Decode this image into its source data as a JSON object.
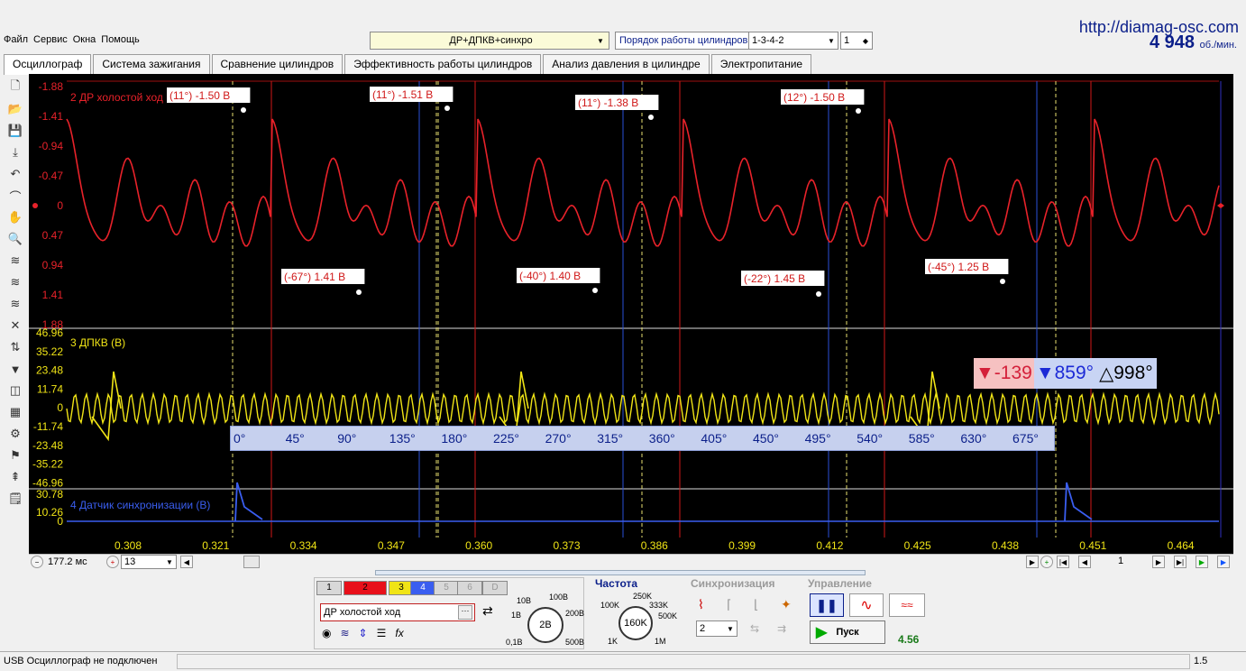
{
  "menu": [
    "Файл",
    "Сервис",
    "Окна",
    "Помощь"
  ],
  "site_url": "http://diamag-osc.com",
  "rpm": {
    "value": "4   948",
    "unit": "об./мин."
  },
  "preset": "ДР+ДПКВ+синхро",
  "cylinder_order": {
    "label": "Порядок работы цилиндров",
    "value": "1-3-4-2",
    "number": "1"
  },
  "tabs": [
    "Осциллограф",
    "Система зажигания",
    "Сравнение цилиндров",
    "Эффективность работы цилиндров",
    "Анализ давления в цилиндре",
    "Электропитание"
  ],
  "active_tab": 0,
  "toolbar_icons": [
    "new-file-icon",
    "open-folder-icon",
    "save-icon",
    "auto-scale-icon",
    "cursor-icon",
    "curve-icon",
    "hand-icon",
    "zoom-icon",
    "waves-icon",
    "waves2-icon",
    "waves3-icon",
    "cross-icon",
    "split-icon",
    "filter-icon",
    "compare-icon",
    "table-icon",
    "settings-auto-icon",
    "flag-icon",
    "marker-icon",
    "note-icon"
  ],
  "scope": {
    "colors": {
      "ch2": "#e8222a",
      "ch3": "#f0e416",
      "ch4": "#3a5ef0",
      "bg": "#000000"
    },
    "ch2": {
      "name": "2 ДР холостой ход",
      "yticks": [
        "-1.88",
        "-1.41",
        "-0.94",
        "-0.47",
        "0",
        "0.47",
        "0.94",
        "1.41",
        "1.88"
      ],
      "labels": [
        "(11°) -1.50 В",
        "(11°) -1.51 В",
        "(11°) -1.38 В",
        "(12°) -1.50 В",
        "(-67°) 1.41 В",
        "(-40°) 1.40 В",
        "(-22°) 1.45 В",
        "(-45°) 1.25 В"
      ]
    },
    "ch3": {
      "name": "3 ДПКВ (В)",
      "yticks": [
        "46.96",
        "35.22",
        "23.48",
        "11.74",
        "0",
        "-11.74",
        "-23.48",
        "-35.22",
        "-46.96"
      ]
    },
    "ch4": {
      "name": "4 Датчик синхронизации (В)",
      "yticks": [
        "30.78",
        "10.26",
        "0"
      ]
    },
    "xticks": [
      "0.308",
      "0.321",
      "0.334",
      "0.347",
      "0.360",
      "0.373",
      "0.386",
      "0.399",
      "0.412",
      "0.425",
      "0.438",
      "0.451",
      "0.464"
    ],
    "angle_ruler": [
      "0°",
      "45°",
      "90°",
      "135°",
      "180°",
      "225°",
      "270°",
      "315°",
      "360°",
      "405°",
      "450°",
      "495°",
      "540°",
      "585°",
      "630°",
      "675°"
    ],
    "cursors": {
      "red": "-139",
      "blue": "859°",
      "delta": "998°"
    }
  },
  "timebase": "177.2 мс",
  "channel_sel": "13",
  "page_number": "1",
  "channel_panel": {
    "buttons": [
      "1",
      "2",
      "3",
      "4",
      "5",
      "6",
      "D"
    ],
    "name": "ДР холостой ход",
    "range_labels": [
      "10В",
      "100В",
      "1В",
      "200В",
      "0,1В",
      "500В"
    ],
    "range_value": "2В"
  },
  "frequency": {
    "title": "Частота",
    "labels": [
      "250K",
      "100K",
      "333K",
      "500K",
      "1K",
      "1M"
    ],
    "value": "160K"
  },
  "sync": {
    "title": "Синхронизация",
    "value": "2"
  },
  "control": {
    "title": "Управление",
    "start": "Пуск",
    "value": "4.56"
  },
  "status": {
    "left": "USB Осциллограф не подключен",
    "right": "1.5"
  }
}
